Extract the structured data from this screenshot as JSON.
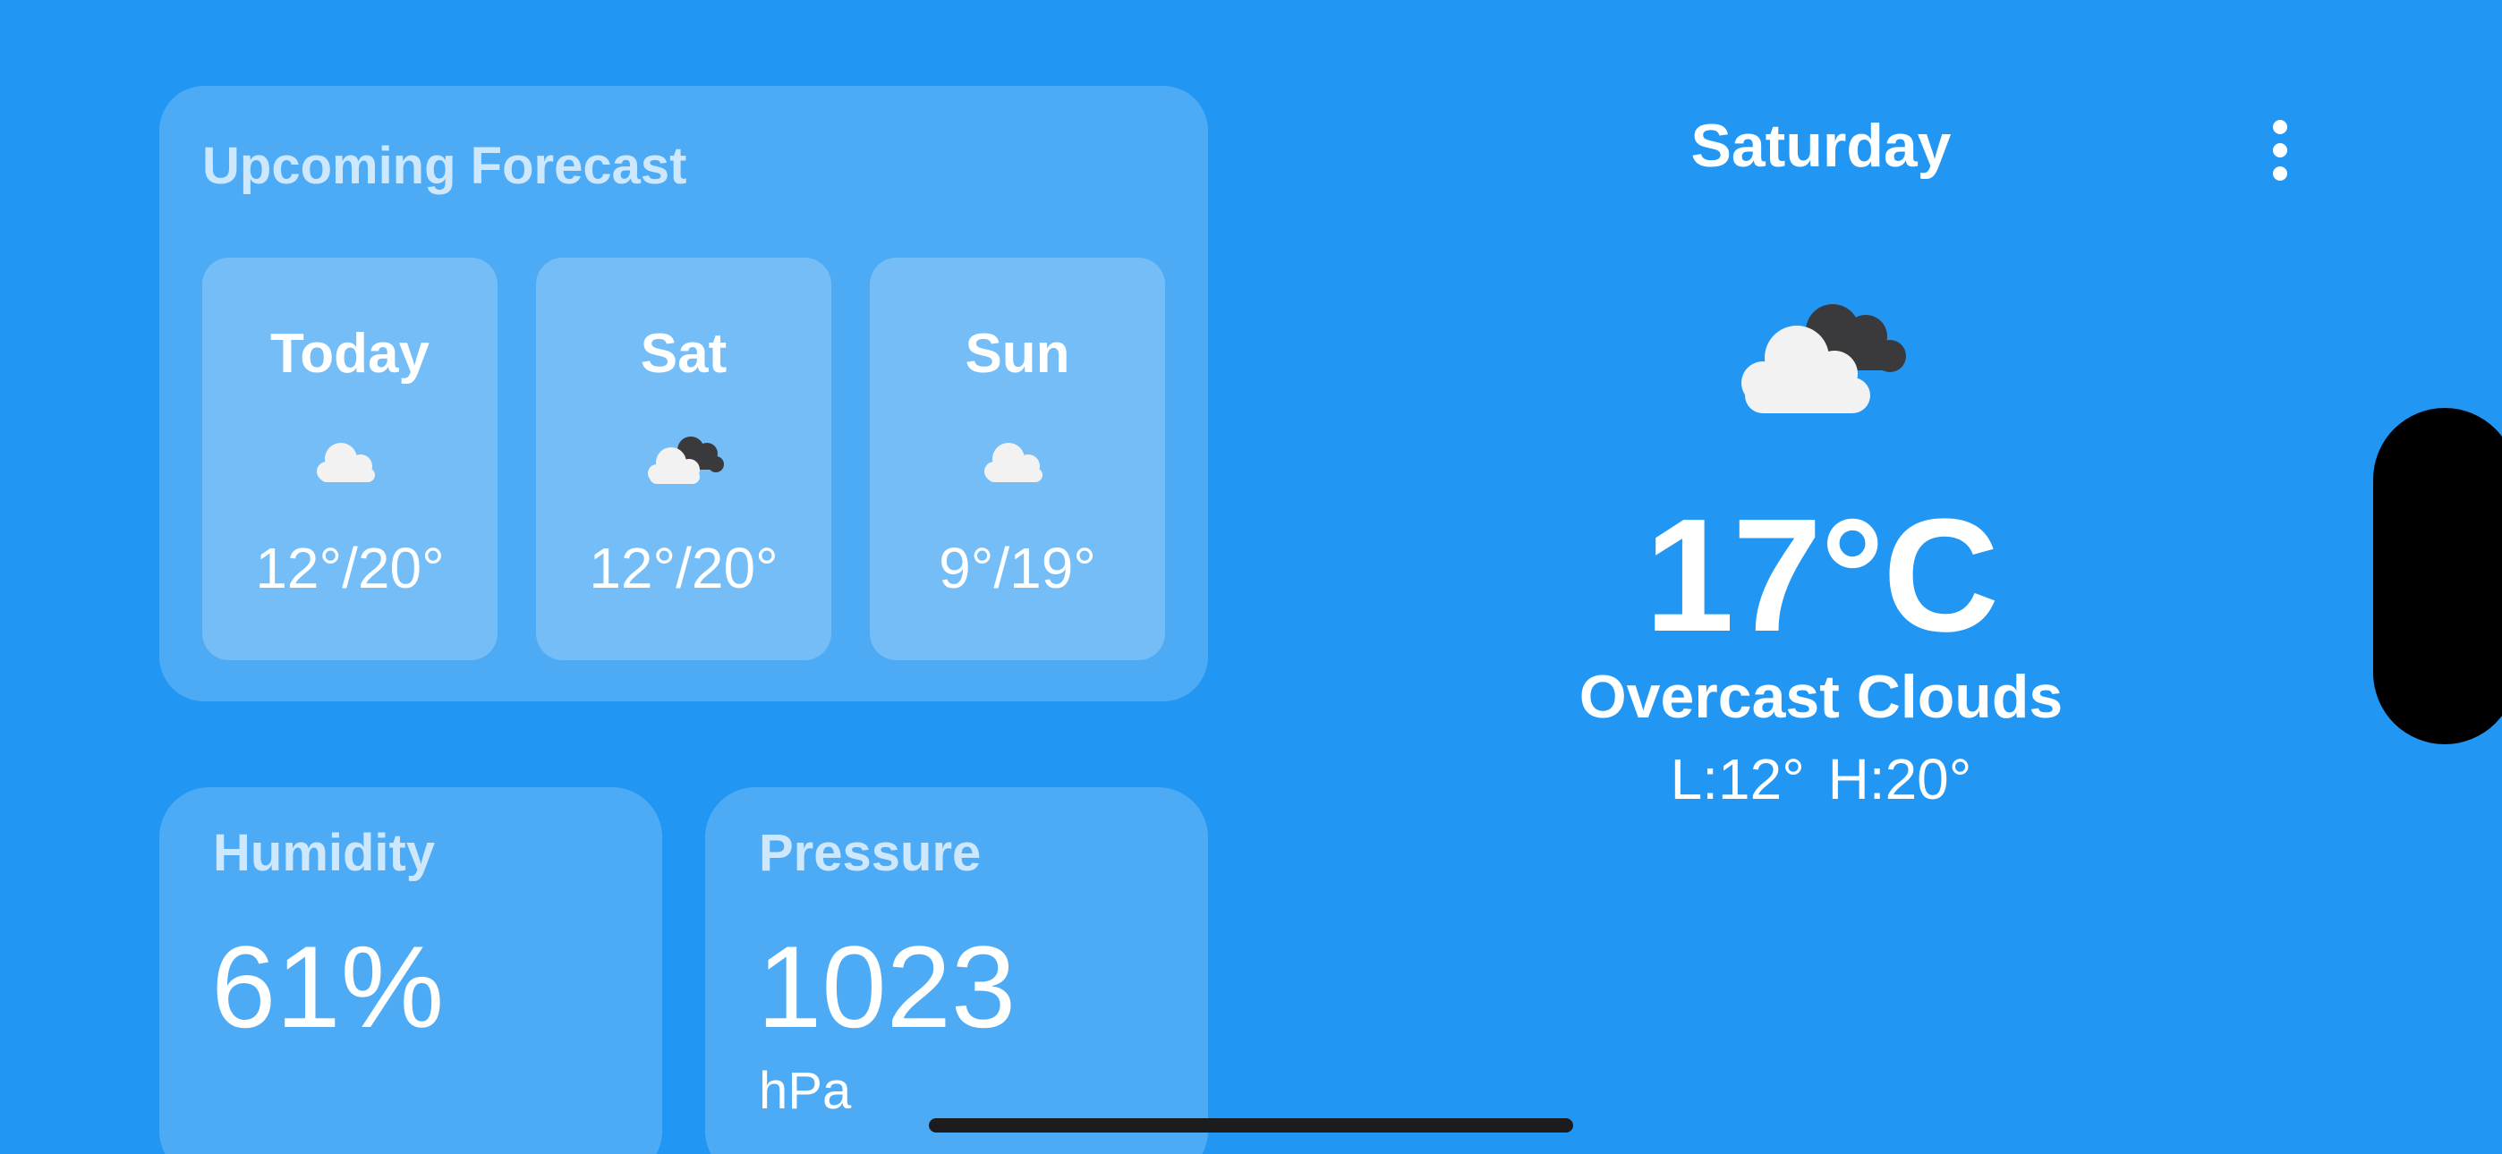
{
  "forecast": {
    "title": "Upcoming Forecast",
    "days": [
      {
        "label": "Today",
        "icon": "cloud-icon",
        "temps": "12°/20°"
      },
      {
        "label": "Sat",
        "icon": "overcast-clouds-icon",
        "temps": "12°/20°"
      },
      {
        "label": "Sun",
        "icon": "cloud-icon",
        "temps": "9°/19°"
      }
    ]
  },
  "humidity": {
    "title": "Humidity",
    "value": "61%"
  },
  "pressure": {
    "title": "Pressure",
    "value": "1023",
    "unit": "hPa"
  },
  "current": {
    "day": "Saturday",
    "icon": "overcast-clouds-icon",
    "temperature": "17°C",
    "description": "Overcast Clouds",
    "low_high": "L:12°  H:20°"
  },
  "colors": {
    "background": "#2196f3",
    "cloud_light": "#f2f2f2",
    "cloud_dark": "#3a3a3c"
  }
}
